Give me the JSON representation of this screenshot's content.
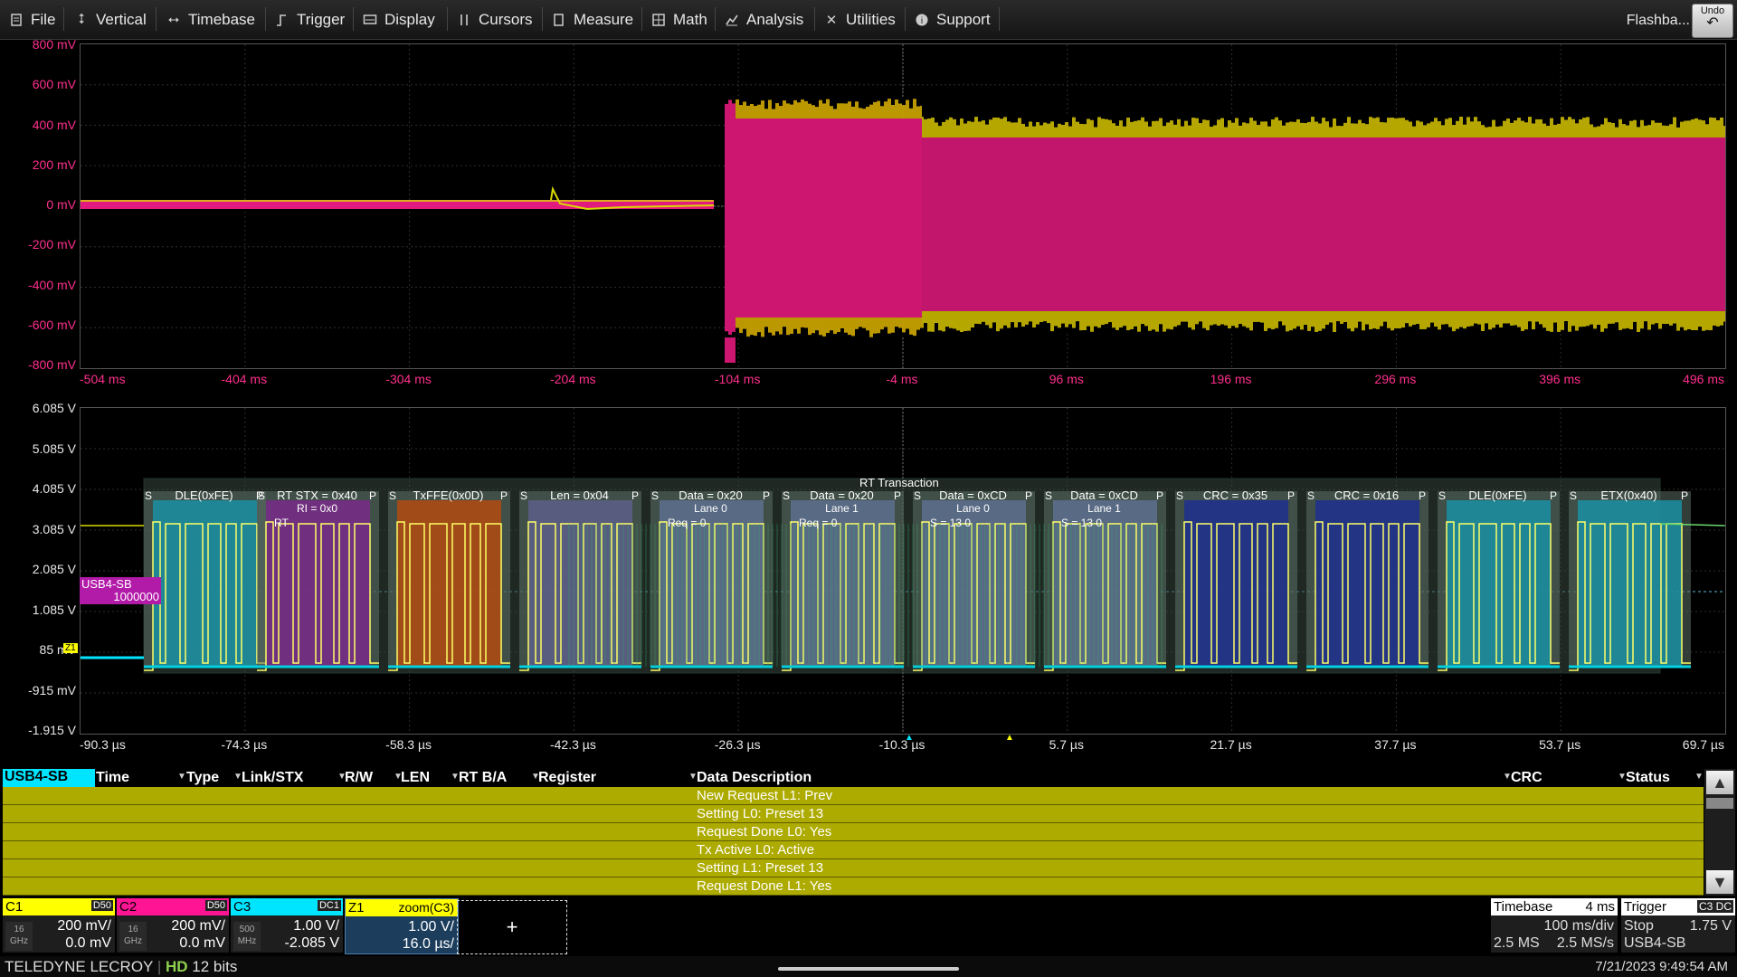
{
  "menu": {
    "items": [
      {
        "label": "File",
        "icon": "file-icon"
      },
      {
        "label": "Vertical",
        "icon": "vertical-icon"
      },
      {
        "label": "Timebase",
        "icon": "timebase-icon"
      },
      {
        "label": "Trigger",
        "icon": "trigger-icon"
      },
      {
        "label": "Display",
        "icon": "display-icon"
      },
      {
        "label": "Cursors",
        "icon": "cursors-icon"
      },
      {
        "label": "Measure",
        "icon": "measure-icon"
      },
      {
        "label": "Math",
        "icon": "math-icon"
      },
      {
        "label": "Analysis",
        "icon": "analysis-icon"
      },
      {
        "label": "Utilities",
        "icon": "utilities-icon"
      },
      {
        "label": "Support",
        "icon": "support-icon"
      }
    ],
    "flashback": "Flashba...",
    "undo": "Undo"
  },
  "top_grid": {
    "y_labels": [
      "800 mV",
      "600 mV",
      "400 mV",
      "200 mV",
      "0 mV",
      "-200 mV",
      "-400 mV",
      "-600 mV",
      "-800 mV"
    ],
    "x_labels": [
      "-504 ms",
      "-404 ms",
      "-304 ms",
      "-204 ms",
      "-104 ms",
      "-4 ms",
      "96 ms",
      "196 ms",
      "296 ms",
      "396 ms",
      "496 ms"
    ],
    "ch_marker": "C2"
  },
  "bottom_grid": {
    "y_labels": [
      "6.085 V",
      "5.085 V",
      "4.085 V",
      "3.085 V",
      "2.085 V",
      "1.085 V",
      "85 mV",
      "-915 mV",
      "-1.915 V"
    ],
    "x_labels": [
      "-90.3 µs",
      "-74.3 µs",
      "-58.3 µs",
      "-42.3 µs",
      "-26.3 µs",
      "-10.3 µs",
      "5.7 µs",
      "21.7 µs",
      "37.7 µs",
      "53.7 µs",
      "69.7 µs"
    ],
    "decoder_name": "USB4-SB",
    "decoder_value": "1000000",
    "z_marker": "Z1",
    "transaction_label": "RT Transaction",
    "packets": [
      {
        "label": "DLE(0xFE)",
        "color": "#1a8fa3"
      },
      {
        "label": "RT STX = 0x40",
        "color": "#7a2a8a",
        "sub1": "RI = 0x0",
        "sub2": "RT"
      },
      {
        "label": "TxFFE(0x0D)",
        "color": "#b34a12"
      },
      {
        "label": "Len = 0x04",
        "color": "#5d5f8a"
      },
      {
        "label": "Data = 0x20",
        "color": "#5d6f8f",
        "sub1": "Lane 0",
        "sub2": "Req = 0"
      },
      {
        "label": "Data = 0x20",
        "color": "#5d6f8f",
        "sub1": "Lane 1",
        "sub2": "Req = 0"
      },
      {
        "label": "Data = 0xCD",
        "color": "#5d6f8f",
        "sub1": "Lane 0",
        "sub2": "S = 13   0"
      },
      {
        "label": "Data = 0xCD",
        "color": "#5d6f8f",
        "sub1": "Lane 1",
        "sub2": "S = 13   0"
      },
      {
        "label": "CRC = 0x35",
        "color": "#1e2f8f"
      },
      {
        "label": "CRC = 0x16",
        "color": "#1e2f8f"
      },
      {
        "label": "DLE(0xFE)",
        "color": "#1a8fa3"
      },
      {
        "label": "ETX(0x40)",
        "color": "#1a8fa3"
      }
    ]
  },
  "table": {
    "headers": [
      "USB4-SB",
      "Time",
      "Type",
      "Link/STX",
      "R/W",
      "LEN",
      "RT B/A",
      "Register",
      "Data Description",
      "CRC",
      "Status"
    ],
    "rows": [
      "New Request L1: Prev",
      "Setting L0: Preset 13",
      "Request Done L0: Yes",
      "Tx Active L0: Active",
      "Setting L1: Preset 13",
      "Request Done L1: Yes"
    ]
  },
  "channels": [
    {
      "name": "C1",
      "coupling": "D50",
      "color": "#ffff00",
      "bw": "16\nGHz",
      "v1": "200 mV/",
      "v2": "0.0 mV"
    },
    {
      "name": "C2",
      "coupling": "D50",
      "color": "#ff1493",
      "bw": "16\nGHz",
      "v1": "200 mV/",
      "v2": "0.0 mV"
    },
    {
      "name": "C3",
      "coupling": "DC1",
      "color": "#00e5ff",
      "bw": "500\nMHz",
      "v1": "1.00 V/",
      "v2": "-2.085 V"
    },
    {
      "name": "Z1",
      "coupling": "zoom(C3)",
      "color": "#ffff00",
      "bw": "",
      "v1": "1.00 V/",
      "v2": "16.0 µs/"
    }
  ],
  "add_label": "+",
  "timebase": {
    "title": "Timebase",
    "value": "4 ms",
    "line1": "100 ms/div",
    "line2a": "2.5 MS",
    "line2b": "2.5 MS/s"
  },
  "trigger": {
    "title": "Trigger",
    "badge": "C3 DC",
    "mode": "Stop",
    "level": "1.75 V",
    "source": "USB4-SB"
  },
  "status": {
    "brand": "TELEDYNE LECROY",
    "hd": "HD",
    "bits": "12 bits",
    "datetime": "7/21/2023 9:49:54 AM"
  },
  "colors": {
    "c1": "#ffff00",
    "c2": "#ff1493",
    "c3": "#00e5ff",
    "table_row": "#adaa00"
  }
}
